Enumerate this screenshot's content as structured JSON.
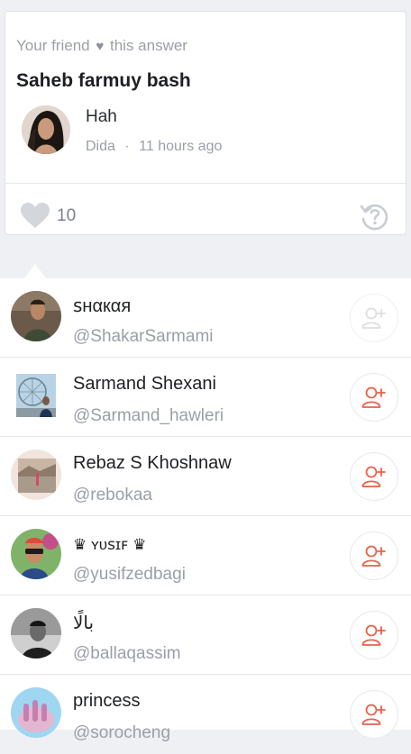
{
  "answer_card": {
    "friend_prefix": "Your friend",
    "heart_glyph": "♥",
    "friend_suffix": "this answer",
    "question": "Saheb farmuy bash",
    "answer": "Hah",
    "author": "Dida",
    "separator": "·",
    "time": "11 hours ago",
    "likes": "10"
  },
  "colors": {
    "accent": "#e8624a",
    "disabled": "#d7d9dd",
    "muted_text": "#9a9fa7",
    "background": "#eef0f4"
  },
  "users": [
    {
      "name": "ꜱʜαкαя",
      "handle": "@ShakarSarmami",
      "follow_enabled": false,
      "avatar": "photo-man-shirt"
    },
    {
      "name": "Sarmand Shexani",
      "handle": "@Sarmand_hawleri",
      "follow_enabled": true,
      "avatar": "photo-ferris-wheel"
    },
    {
      "name": "Rebaz S Khoshnaw",
      "handle": "@rebokaa",
      "follow_enabled": true,
      "avatar": "photo-landscape"
    },
    {
      "name": "♛ ʏᴜꜱɪꜰ ♛",
      "handle": "@yusifzedbagi",
      "follow_enabled": true,
      "avatar": "photo-sunglasses"
    },
    {
      "name": "بالًا",
      "handle": "@ballaqassim",
      "follow_enabled": true,
      "avatar": "photo-bw-man"
    },
    {
      "name": "princess",
      "handle": "@sorocheng",
      "follow_enabled": true,
      "avatar": "photo-nails"
    }
  ]
}
